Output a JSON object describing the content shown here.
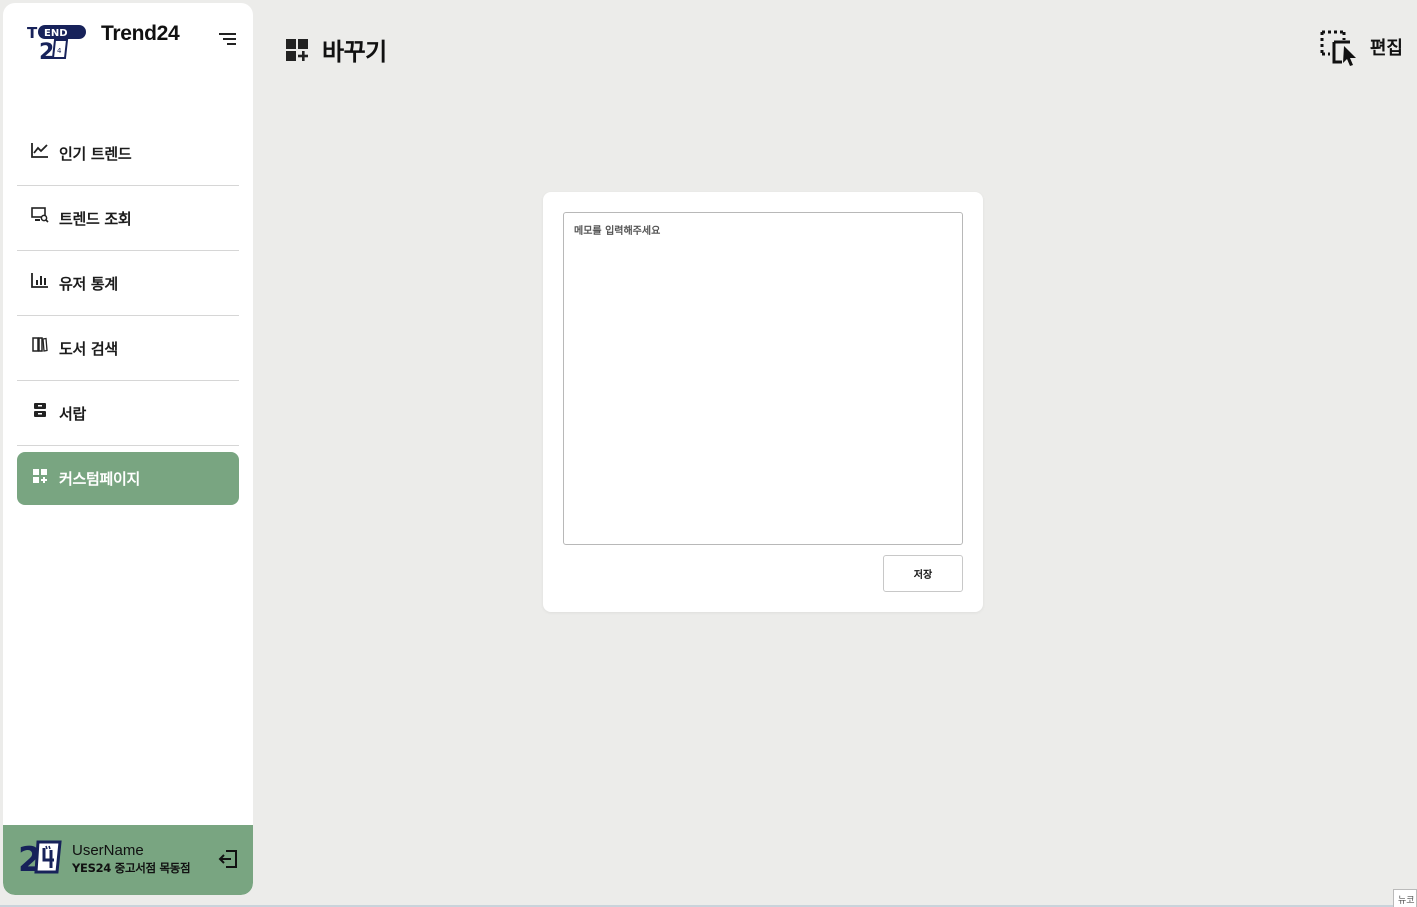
{
  "app": {
    "name": "Trend24"
  },
  "sidebar": {
    "items": [
      {
        "label": "인기 트렌드",
        "icon": "trending-chart-icon"
      },
      {
        "label": "트렌드 조회",
        "icon": "monitor-search-icon"
      },
      {
        "label": "유저 통계",
        "icon": "bar-chart-icon"
      },
      {
        "label": "도서 검색",
        "icon": "books-icon"
      },
      {
        "label": "서랍",
        "icon": "drawer-icon"
      },
      {
        "label": "커스텀페이지",
        "icon": "dashboard-add-icon",
        "active": true
      }
    ]
  },
  "user": {
    "name": "UserName",
    "store": "YES24 중고서점 목동점"
  },
  "header": {
    "title": "바꾸기",
    "edit_label": "편집"
  },
  "memo": {
    "placeholder": "메모를 입력해주세요",
    "value": "",
    "save_label": "저장"
  },
  "colors": {
    "accent": "#79a581",
    "background": "#ececea",
    "logo_navy": "#17225a"
  },
  "corner_tab": {
    "label": "뉴코"
  }
}
